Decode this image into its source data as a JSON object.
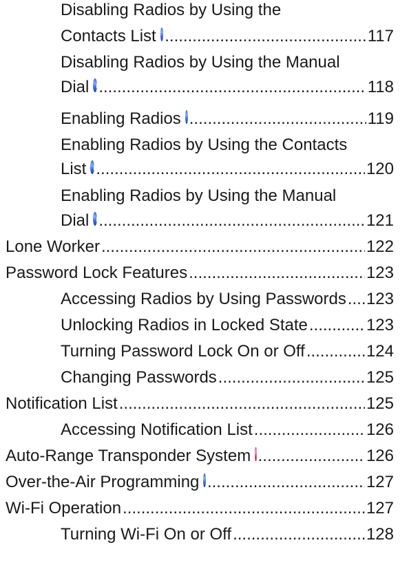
{
  "toc": {
    "entries": [
      {
        "id": "e1a",
        "text": "Disabling Radios by Using the"
      },
      {
        "id": "e1b",
        "text": "Contacts List",
        "icon": "dmr-icon",
        "page": "117"
      },
      {
        "id": "e2a",
        "text": "Disabling Radios by Using the Manual"
      },
      {
        "id": "e2b",
        "text": "Dial",
        "icon": "dmr-icon",
        "page": "118"
      },
      {
        "id": "e3",
        "text": "Enabling Radios",
        "icon": "dmr-icon",
        "page": "119"
      },
      {
        "id": "e4a",
        "text": "Enabling Radios by Using the Contacts"
      },
      {
        "id": "e4b",
        "text": "List",
        "icon": "dmr-icon",
        "page": "120"
      },
      {
        "id": "e5a",
        "text": "Enabling Radios by Using the Manual"
      },
      {
        "id": "e5b",
        "text": "Dial",
        "icon": "dmr-icon",
        "page": "121"
      },
      {
        "id": "e6",
        "text": "Lone Worker",
        "page": "122"
      },
      {
        "id": "e7",
        "text": "Password Lock Features",
        "page": "123"
      },
      {
        "id": "e8",
        "text": "Accessing Radios by Using Passwords",
        "page": "123"
      },
      {
        "id": "e9",
        "text": "Unlocking Radios in Locked State",
        "page": "123"
      },
      {
        "id": "e10",
        "text": "Turning Password Lock On or Off",
        "page": "124"
      },
      {
        "id": "e11",
        "text": "Changing Passwords",
        "page": "125"
      },
      {
        "id": "e12",
        "text": "Notification List ",
        "page": "125"
      },
      {
        "id": "e13",
        "text": "Accessing Notification List ",
        "page": "126"
      },
      {
        "id": "e14",
        "text": "Auto-Range Transponder System",
        "icon": "ars-icon",
        "page": "126"
      },
      {
        "id": "e15",
        "text": "Over-the-Air Programming",
        "icon": "dmr-icon",
        "page": "127"
      },
      {
        "id": "e16",
        "text": "Wi-Fi Operation",
        "page": "127"
      },
      {
        "id": "e17",
        "text": "Turning Wi-Fi On or Off",
        "page": "128"
      }
    ]
  }
}
